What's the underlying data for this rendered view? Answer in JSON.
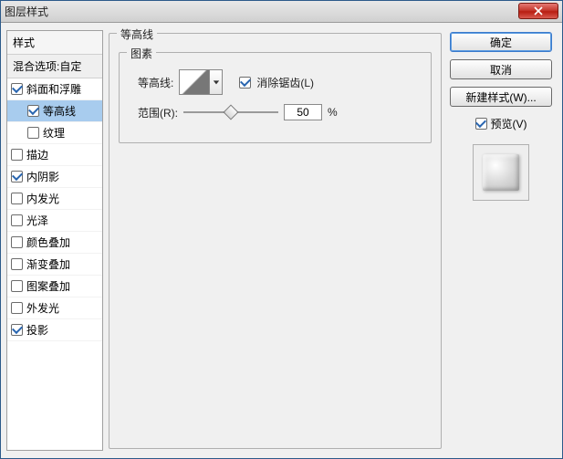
{
  "window": {
    "title": "图层样式"
  },
  "styles": {
    "header": "样式",
    "blend": "混合选项:自定",
    "items": [
      {
        "label": "斜面和浮雕",
        "checked": true,
        "selected": false,
        "indent": false
      },
      {
        "label": "等高线",
        "checked": true,
        "selected": true,
        "indent": true
      },
      {
        "label": "纹理",
        "checked": false,
        "selected": false,
        "indent": true
      },
      {
        "label": "描边",
        "checked": false,
        "selected": false,
        "indent": false
      },
      {
        "label": "内阴影",
        "checked": true,
        "selected": false,
        "indent": false
      },
      {
        "label": "内发光",
        "checked": false,
        "selected": false,
        "indent": false
      },
      {
        "label": "光泽",
        "checked": false,
        "selected": false,
        "indent": false
      },
      {
        "label": "颜色叠加",
        "checked": false,
        "selected": false,
        "indent": false
      },
      {
        "label": "渐变叠加",
        "checked": false,
        "selected": false,
        "indent": false
      },
      {
        "label": "图案叠加",
        "checked": false,
        "selected": false,
        "indent": false
      },
      {
        "label": "外发光",
        "checked": false,
        "selected": false,
        "indent": false
      },
      {
        "label": "投影",
        "checked": true,
        "selected": false,
        "indent": false
      }
    ]
  },
  "center": {
    "group_title": "等高线",
    "elements_title": "图素",
    "contour_label": "等高线:",
    "antialias_label": "消除锯齿(L)",
    "antialias_checked": true,
    "range_label": "范围(R):",
    "range_value": "50",
    "range_percent": "%",
    "range_slider_pos": 50
  },
  "right": {
    "ok": "确定",
    "cancel": "取消",
    "new_style": "新建样式(W)...",
    "preview_label": "预览(V)",
    "preview_checked": true
  }
}
